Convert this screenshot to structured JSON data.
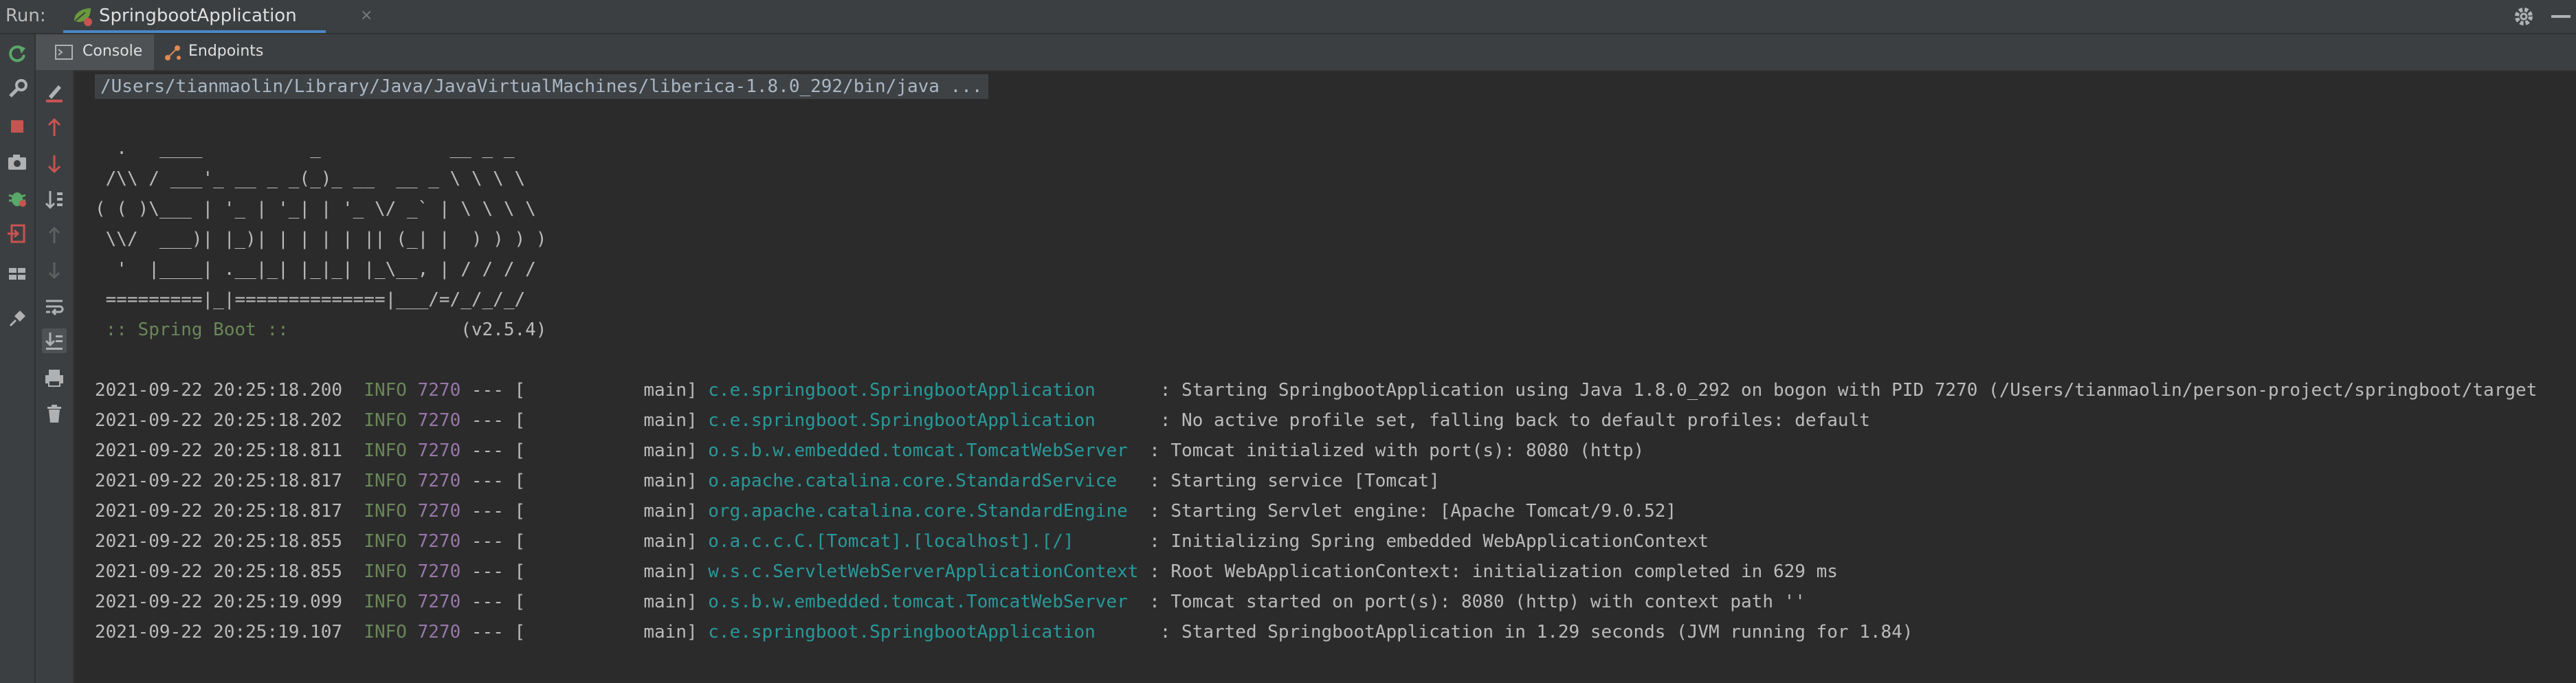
{
  "run_bar": {
    "label": "Run:",
    "tab_title": "SpringbootApplication",
    "close_glyph": "×",
    "tab_icon": "spring-boot-app-icon",
    "settings_icon": "gear-icon",
    "minimize_icon": "minimize-icon"
  },
  "subtabs": [
    {
      "label": "Console",
      "icon": "console-icon",
      "active": true
    },
    {
      "label": "Endpoints",
      "icon": "endpoints-icon",
      "active": false
    }
  ],
  "left_toolbar": [
    "rerun-icon",
    "build-icon",
    "stop-icon",
    "camera-icon",
    "debug-icon",
    "exit-icon",
    "layout-icon",
    "pin-icon"
  ],
  "console_toolbar": [
    "clear-icon",
    "up-arrow-icon",
    "down-arrow-icon",
    "sort-icon",
    "up-arrow-disabled-icon",
    "down-arrow-disabled-icon",
    "soft-wrap-icon",
    "scroll-to-end-icon",
    "print-icon",
    "trash-icon"
  ],
  "console": {
    "command": "/Users/tianmaolin/Library/Java/JavaVirtualMachines/liberica-1.8.0_292/bin/java ...",
    "banner": [
      "  .   ____          _            __ _ _",
      " /\\\\ / ___'_ __ _ _(_)_ __  __ _ \\ \\ \\ \\",
      "( ( )\\___ | '_ | '_| | '_ \\/ _` | \\ \\ \\ \\",
      " \\\\/  ___)| |_)| | | | | || (_| |  ) ) ) )",
      "  '  |____| .__|_| |_|_| |_\\__, | / / / /",
      " =========|_|==============|___/=/_/_/_/"
    ],
    "spring_tag": " :: Spring Boot :: ",
    "spring_version": "               (v2.5.4)",
    "logs": [
      {
        "ts": "2021-09-22 20:25:18.200",
        "level": "INFO",
        "pid": "7270",
        "sep": " --- [           main] ",
        "logger": "c.e.springboot.SpringbootApplication     ",
        "msg": " : Starting SpringbootApplication using Java 1.8.0_292 on bogon with PID 7270 (/Users/tianmaolin/person-project/springboot/target"
      },
      {
        "ts": "2021-09-22 20:25:18.202",
        "level": "INFO",
        "pid": "7270",
        "sep": " --- [           main] ",
        "logger": "c.e.springboot.SpringbootApplication     ",
        "msg": " : No active profile set, falling back to default profiles: default"
      },
      {
        "ts": "2021-09-22 20:25:18.811",
        "level": "INFO",
        "pid": "7270",
        "sep": " --- [           main] ",
        "logger": "o.s.b.w.embedded.tomcat.TomcatWebServer  ",
        "msg": ": Tomcat initialized with port(s): 8080 (http)"
      },
      {
        "ts": "2021-09-22 20:25:18.817",
        "level": "INFO",
        "pid": "7270",
        "sep": " --- [           main] ",
        "logger": "o.apache.catalina.core.StandardService   ",
        "msg": ": Starting service [Tomcat]"
      },
      {
        "ts": "2021-09-22 20:25:18.817",
        "level": "INFO",
        "pid": "7270",
        "sep": " --- [           main] ",
        "logger": "org.apache.catalina.core.StandardEngine  ",
        "msg": ": Starting Servlet engine: [Apache Tomcat/9.0.52]"
      },
      {
        "ts": "2021-09-22 20:25:18.855",
        "level": "INFO",
        "pid": "7270",
        "sep": " --- [           main] ",
        "logger": "o.a.c.c.C.[Tomcat].[localhost].[/]       ",
        "msg": ": Initializing Spring embedded WebApplicationContext"
      },
      {
        "ts": "2021-09-22 20:25:18.855",
        "level": "INFO",
        "pid": "7270",
        "sep": " --- [           main] ",
        "logger": "w.s.c.ServletWebServerApplicationContext ",
        "msg": ": Root WebApplicationContext: initialization completed in 629 ms"
      },
      {
        "ts": "2021-09-22 20:25:19.099",
        "level": "INFO",
        "pid": "7270",
        "sep": " --- [           main] ",
        "logger": "o.s.b.w.embedded.tomcat.TomcatWebServer  ",
        "msg": ": Tomcat started on port(s): 8080 (http) with context path ''"
      },
      {
        "ts": "2021-09-22 20:25:19.107",
        "level": "INFO",
        "pid": "7270",
        "sep": " --- [           main] ",
        "logger": "c.e.springboot.SpringbootApplication     ",
        "msg": " : Started SpringbootApplication in 1.29 seconds (JVM running for 1.84)"
      }
    ]
  },
  "colors": {
    "background": "#2b2b2b",
    "toolbar": "#3c3f41",
    "level_info": "#6a8759",
    "pid": "#9876aa",
    "logger": "#299999",
    "accent": "#4a88c7"
  }
}
